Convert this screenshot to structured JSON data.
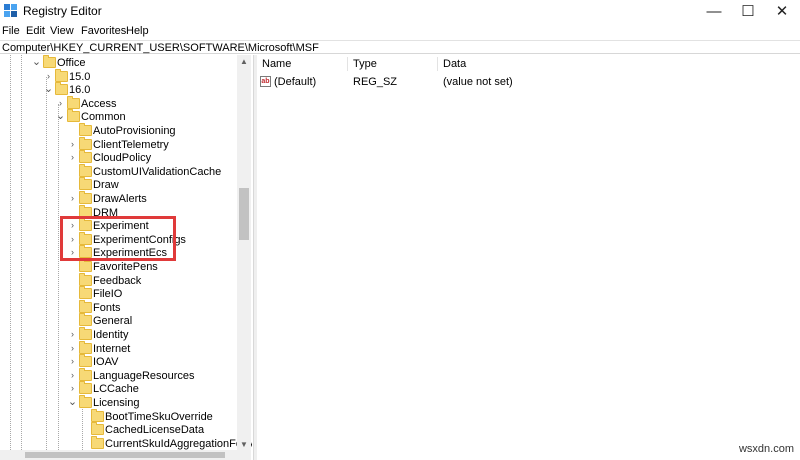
{
  "window": {
    "title": "Registry Editor",
    "minimize_glyph": "—",
    "maximize_glyph": "☐",
    "close_glyph": "✕"
  },
  "menu": [
    "File",
    "Edit",
    "View",
    "Favorites",
    "Help"
  ],
  "address": "Computer\\HKEY_CURRENT_USER\\SOFTWARE\\Microsoft\\MSF",
  "tree": [
    {
      "label": "Office",
      "level": 0,
      "state": "expanded"
    },
    {
      "label": "15.0",
      "level": 1,
      "state": "collapsed"
    },
    {
      "label": "16.0",
      "level": 1,
      "state": "expanded"
    },
    {
      "label": "Access",
      "level": 2,
      "state": "collapsed"
    },
    {
      "label": "Common",
      "level": 2,
      "state": "expanded"
    },
    {
      "label": "AutoProvisioning",
      "level": 3,
      "state": "none"
    },
    {
      "label": "ClientTelemetry",
      "level": 3,
      "state": "collapsed"
    },
    {
      "label": "CloudPolicy",
      "level": 3,
      "state": "collapsed"
    },
    {
      "label": "CustomUIValidationCache",
      "level": 3,
      "state": "none"
    },
    {
      "label": "Draw",
      "level": 3,
      "state": "none"
    },
    {
      "label": "DrawAlerts",
      "level": 3,
      "state": "collapsed"
    },
    {
      "label": "DRM",
      "level": 3,
      "state": "none"
    },
    {
      "label": "Experiment",
      "level": 3,
      "state": "collapsed"
    },
    {
      "label": "ExperimentConfigs",
      "level": 3,
      "state": "collapsed"
    },
    {
      "label": "ExperimentEcs",
      "level": 3,
      "state": "collapsed"
    },
    {
      "label": "FavoritePens",
      "level": 3,
      "state": "none"
    },
    {
      "label": "Feedback",
      "level": 3,
      "state": "none"
    },
    {
      "label": "FileIO",
      "level": 3,
      "state": "none"
    },
    {
      "label": "Fonts",
      "level": 3,
      "state": "none"
    },
    {
      "label": "General",
      "level": 3,
      "state": "none"
    },
    {
      "label": "Identity",
      "level": 3,
      "state": "collapsed"
    },
    {
      "label": "Internet",
      "level": 3,
      "state": "collapsed"
    },
    {
      "label": "IOAV",
      "level": 3,
      "state": "collapsed"
    },
    {
      "label": "LanguageResources",
      "level": 3,
      "state": "collapsed"
    },
    {
      "label": "LCCache",
      "level": 3,
      "state": "collapsed"
    },
    {
      "label": "Licensing",
      "level": 3,
      "state": "expanded"
    },
    {
      "label": "BootTimeSkuOverride",
      "level": 4,
      "state": "none"
    },
    {
      "label": "CachedLicenseData",
      "level": 4,
      "state": "none"
    },
    {
      "label": "CurrentSkuIdAggregationForApp",
      "level": 4,
      "state": "none"
    }
  ],
  "list": {
    "columns": [
      "Name",
      "Type",
      "Data"
    ],
    "rows": [
      {
        "name": "(Default)",
        "type": "REG_SZ",
        "data": "(value not set)"
      }
    ],
    "value_icon_text": "ab"
  },
  "watermark": "wsxdn.com",
  "colors": {
    "highlight": "#e03a3a",
    "folder": "#f7d976"
  }
}
